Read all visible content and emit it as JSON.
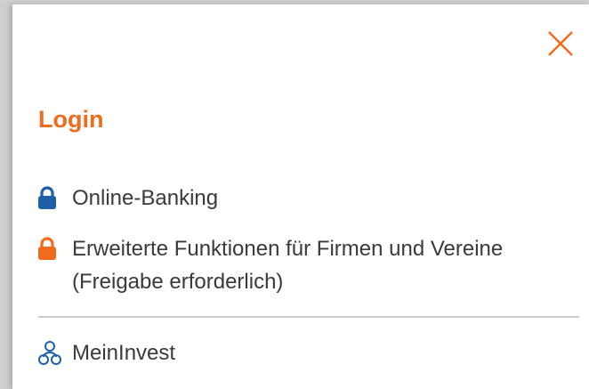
{
  "panel": {
    "title": "Login",
    "close_icon": "close-icon",
    "accent_color": "#f26a1b",
    "items": [
      {
        "label": "Online-Banking",
        "icon": "lock-icon",
        "icon_color": "#1f5fa8"
      },
      {
        "label": "Erweiterte Funktionen für Firmen und Vereine (Freigabe erforderlich)",
        "icon": "lock-icon",
        "icon_color": "#f26a1b"
      },
      {
        "label": "MeinInvest",
        "icon": "person-group-icon",
        "icon_color": "#1f5fa8"
      }
    ]
  }
}
